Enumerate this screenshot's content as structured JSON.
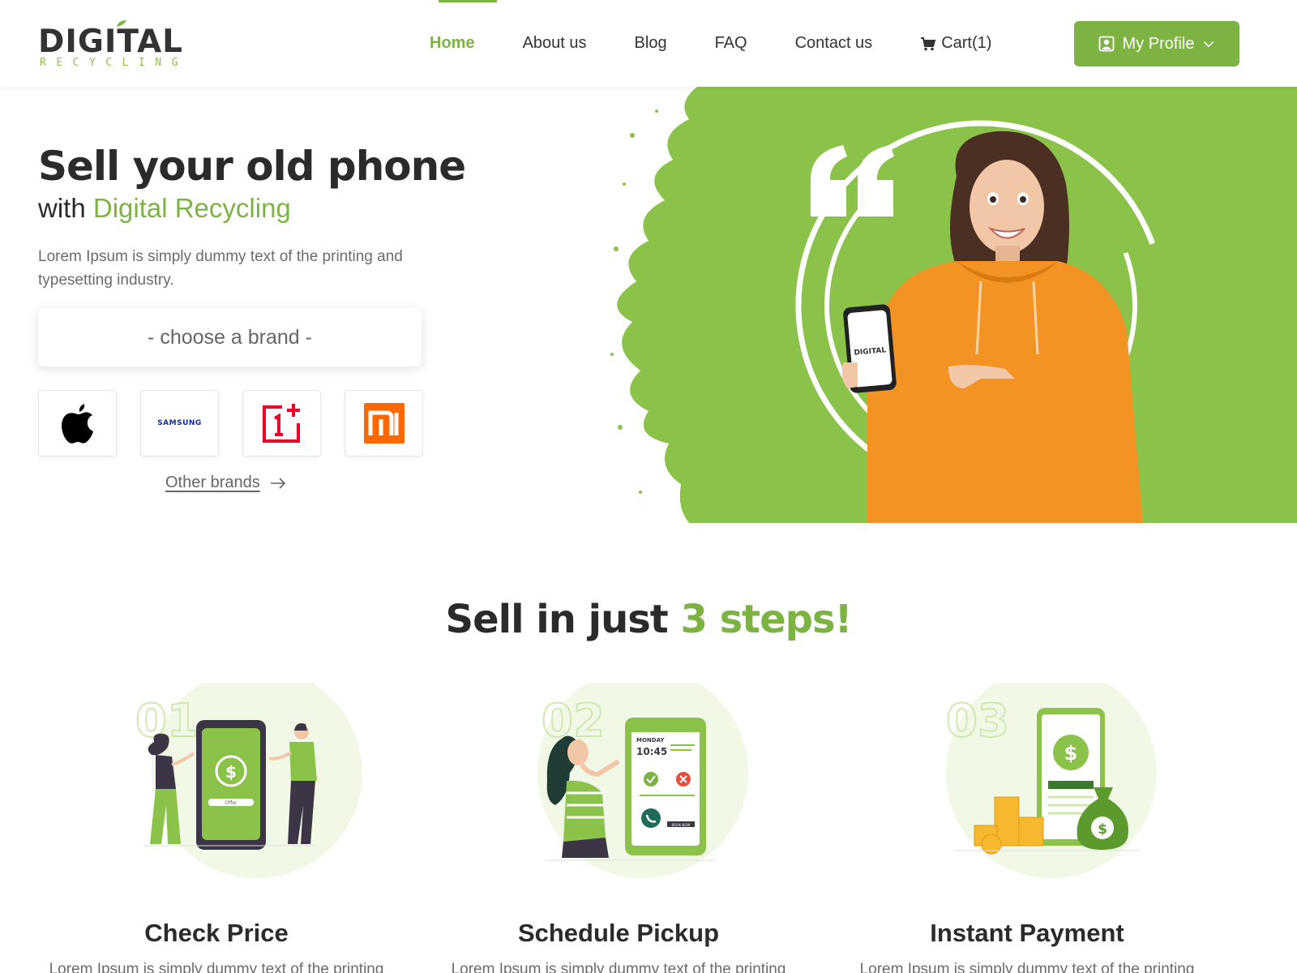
{
  "brand": {
    "logo_main": "DIGITAL",
    "logo_sub": "RECYCLING"
  },
  "nav": {
    "items": [
      {
        "label": "Home",
        "active": true
      },
      {
        "label": "About us"
      },
      {
        "label": "Blog"
      },
      {
        "label": "FAQ"
      },
      {
        "label": "Contact us"
      }
    ],
    "cart_label": "Cart(1)",
    "profile_label": "My Profile"
  },
  "hero": {
    "title": "Sell your old phone",
    "subtitle_prefix": "with ",
    "subtitle_accent": "Digital Recycling",
    "description": "Lorem Ipsum is simply dummy text of the printing and typesetting industry.",
    "brand_select_placeholder": "- choose a brand -",
    "brand_tiles": [
      {
        "name": "apple-logo"
      },
      {
        "name": "samsung-logo",
        "text": "SAMSUNG"
      },
      {
        "name": "oneplus-logo"
      },
      {
        "name": "mi-logo"
      }
    ],
    "other_brands_label": "Other brands",
    "phone_screen_text": "DIGITAL"
  },
  "steps": {
    "title_prefix": "Sell in just ",
    "title_accent": "3 steps!",
    "items": [
      {
        "number": "01",
        "title": "Check Price",
        "description": "Lorem Ipsum is simply dummy text of the printing",
        "offer_label": "Offer"
      },
      {
        "number": "02",
        "title": "Schedule Pickup",
        "description": "Lorem Ipsum is simply dummy text of the printing",
        "day": "MONDAY",
        "time": "10:45",
        "button_label": "BOOK NOW"
      },
      {
        "number": "03",
        "title": "Instant Payment",
        "description": "Lorem Ipsum is simply dummy text of the printing"
      }
    ]
  },
  "colors": {
    "accent": "#7cb342",
    "hero_bg": "#8bc34a",
    "hoodie": "#f39323",
    "text_dark": "#2b2b2b"
  }
}
